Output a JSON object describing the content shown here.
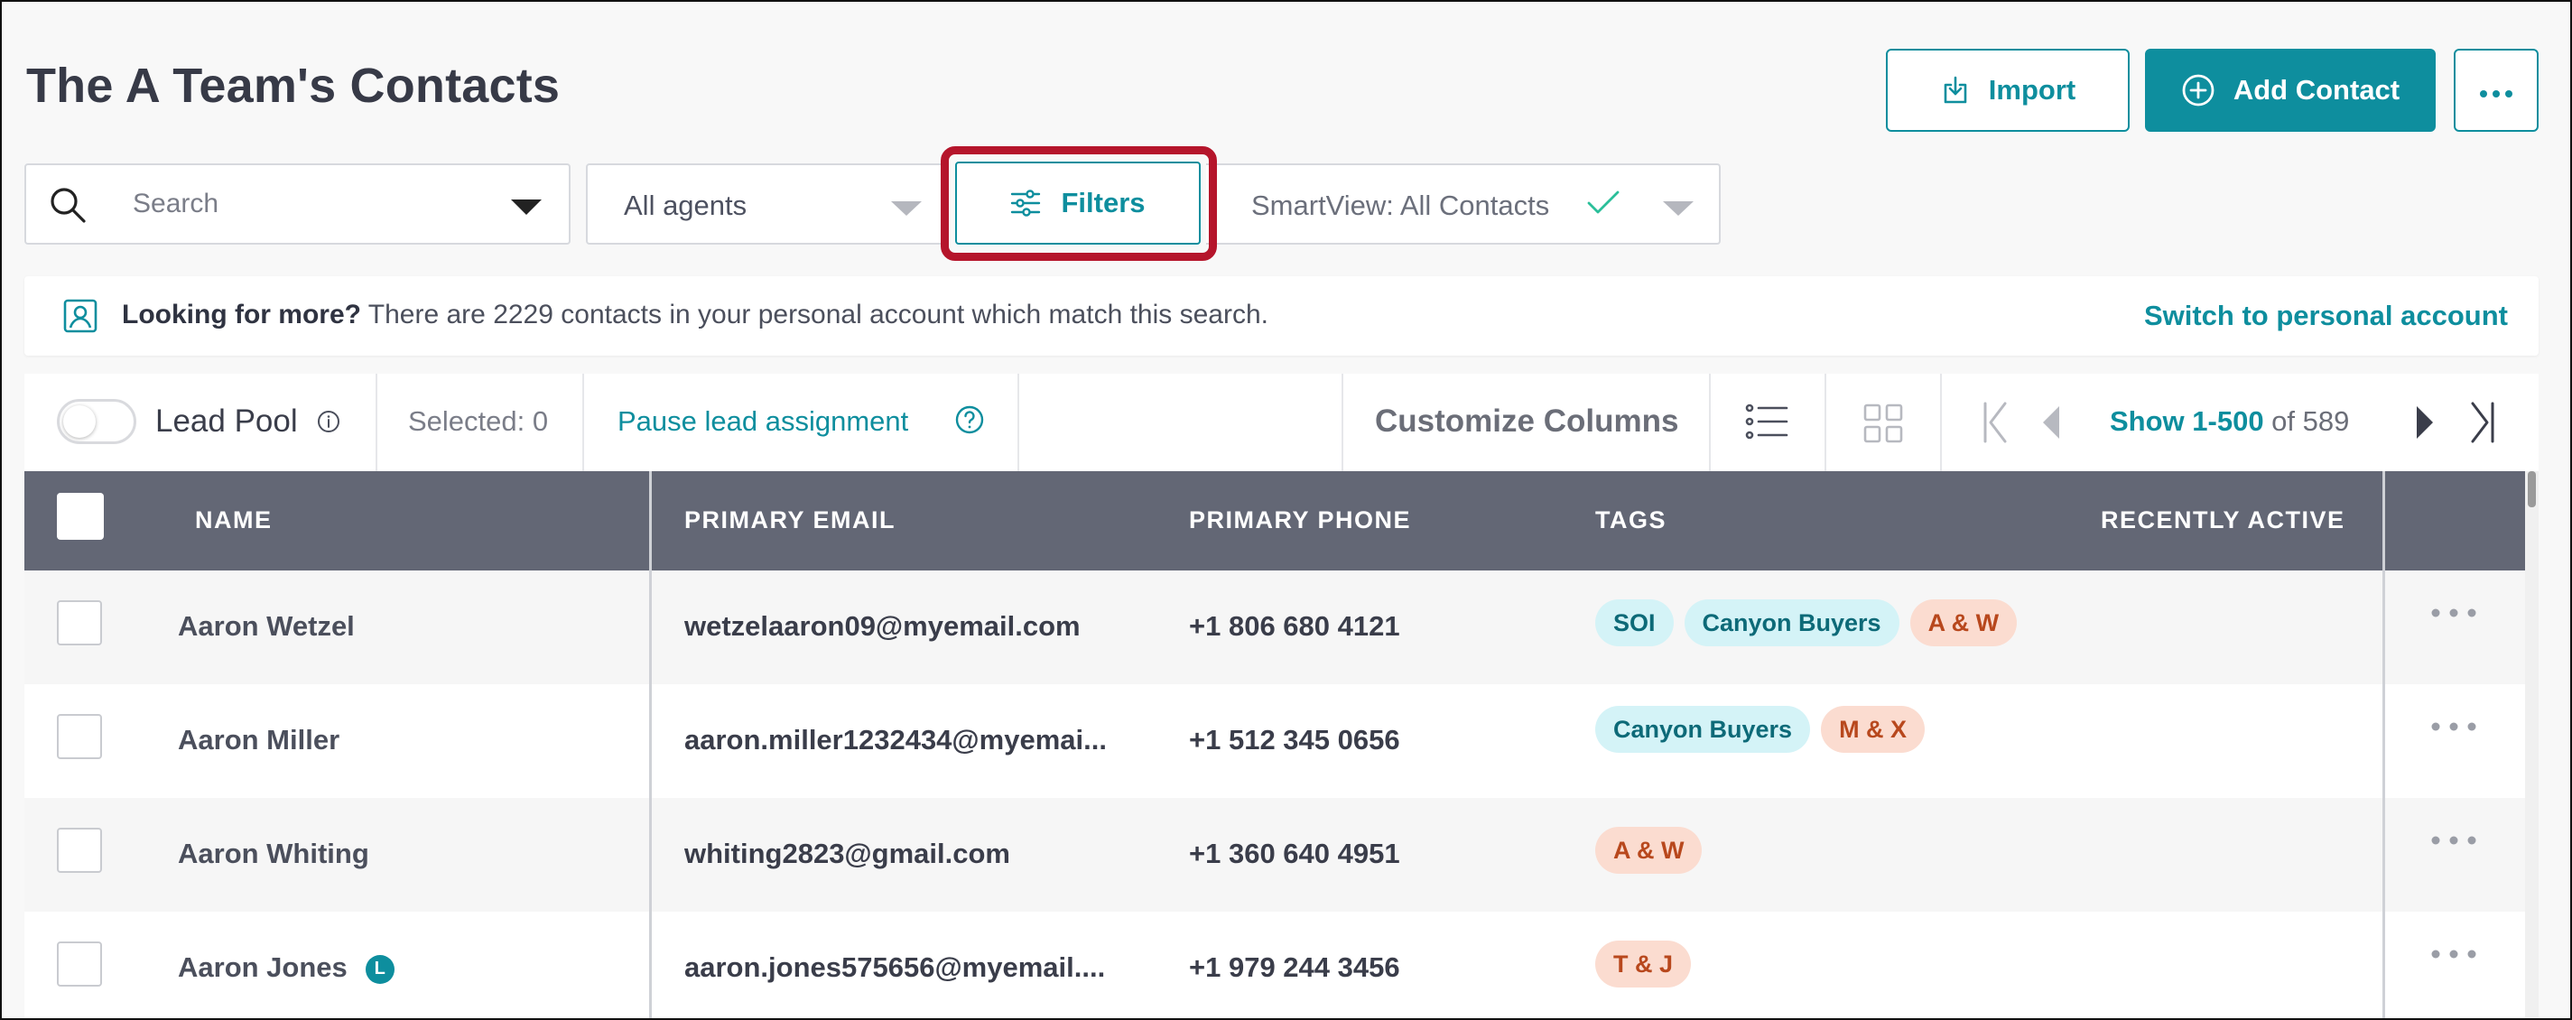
{
  "header": {
    "title": "The A Team's Contacts",
    "import_label": "Import",
    "add_contact_label": "Add Contact"
  },
  "filters": {
    "search_placeholder": "Search",
    "agents_label": "All agents",
    "filters_label": "Filters",
    "smartview_label": "SmartView: All Contacts"
  },
  "banner": {
    "bold_text": "Looking for more?",
    "text": " There are 2229 contacts in your personal account which match this search.",
    "link": "Switch to personal account"
  },
  "toolbar": {
    "lead_pool_label": "Lead Pool",
    "selected_label": "Selected: 0",
    "pause_label": "Pause lead assignment",
    "customize_label": "Customize Columns",
    "page_show": "Show 1-500",
    "page_of": " of 589"
  },
  "table": {
    "columns": [
      "NAME",
      "PRIMARY EMAIL",
      "PRIMARY PHONE",
      "TAGS",
      "RECENTLY ACTIVE"
    ],
    "rows": [
      {
        "name": "Aaron Wetzel",
        "email": "wetzelaaron09@myemail.com",
        "phone": "+1 806 680 4121",
        "tags": [
          "SOI",
          "Canyon Buyers",
          "A & W"
        ]
      },
      {
        "name": "Aaron Miller",
        "email": "aaron.miller1232434@myemai...",
        "phone": "+1 512 345 0656",
        "tags": [
          "Canyon Buyers",
          "M & X"
        ]
      },
      {
        "name": "Aaron Whiting",
        "email": "whiting2823@gmail.com",
        "phone": "+1 360 640 4951",
        "tags": [
          "A & W"
        ]
      },
      {
        "name": "Aaron Jones",
        "badge": "L",
        "email": "aaron.jones575656@myemail....",
        "phone": "+1 979 244 3456",
        "tags": [
          "T & J"
        ]
      }
    ]
  },
  "colors": {
    "accent": "#0e8e9e",
    "highlight": "#b5152b",
    "table_header": "#636775",
    "tag_blue_bg": "#d4f3f7",
    "tag_orange_bg": "#fbdcd0"
  }
}
